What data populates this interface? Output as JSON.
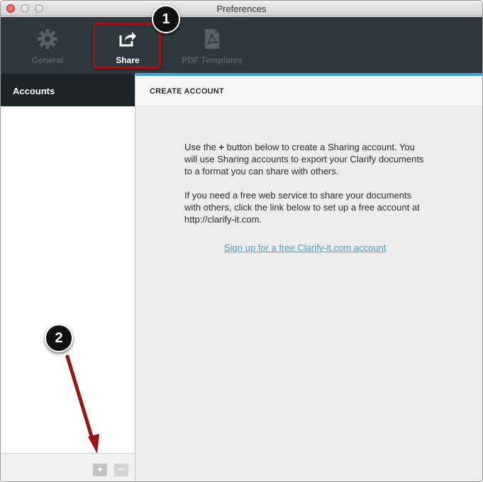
{
  "window": {
    "title": "Preferences"
  },
  "toolbar": {
    "items": [
      {
        "label": "General",
        "icon": "gear-icon"
      },
      {
        "label": "Share",
        "icon": "share-icon"
      },
      {
        "label": "PDF Templates",
        "icon": "pdf-icon"
      }
    ]
  },
  "sidebar": {
    "header": "Accounts",
    "add_label": "+",
    "remove_label": "−"
  },
  "main": {
    "header": "CREATE ACCOUNT",
    "paragraph1_pre": "Use the ",
    "paragraph1_bold": "+",
    "paragraph1_post": " button below to create a Sharing account. You will use Sharing accounts to export your Clarify documents to a format you can share with others.",
    "paragraph2": "If you need a free web service to share your documents with others, click the link below to set up a free account at http://clarify-it.com.",
    "signup_link": "Sign up for a free Clarify-it.com account"
  },
  "callouts": {
    "one": "1",
    "two": "2"
  },
  "colors": {
    "accent": "#3ba1d6",
    "highlight": "#a01818",
    "toolbar": "#2f383e"
  }
}
